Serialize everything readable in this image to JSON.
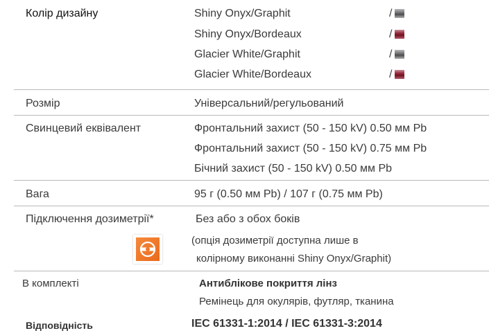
{
  "design_color": {
    "label": "Колір дизайну",
    "options": [
      {
        "name": "Shiny Onyx/Graphit",
        "separator": "/",
        "swatch": "graphit",
        "color": "#5a5a5e"
      },
      {
        "name": "Shiny Onyx/Bordeaux",
        "separator": "/",
        "swatch": "bordeaux",
        "color": "#8a2535"
      },
      {
        "name": "Glacier White/Graphit",
        "separator": "/",
        "swatch": "graphit",
        "color": "#5a5a5e"
      },
      {
        "name": "Glacier White/Bordeaux",
        "separator": "/",
        "swatch": "bordeaux",
        "color": "#8a2535"
      }
    ]
  },
  "size": {
    "label": "Розмір",
    "value": "Універсальний/регульований"
  },
  "lead_equivalent": {
    "label": "Свинцевий еквівалент",
    "values": [
      "Фронтальний захист (50 - 150 kV) 0.50 мм Pb",
      "Фронтальний захист (50 - 150 kV) 0.75 мм Pb",
      "Бічний захист (50 - 150 kV) 0.50 мм Pb"
    ]
  },
  "weight": {
    "label": "Вага",
    "value": "95 г (0.50 мм Pb) / 107 г (0.75 мм Pb)"
  },
  "dosimetry": {
    "label": "Підключення дозиметрії*",
    "value": "Без або з обох боків",
    "note_line1": "(опція дозиметрії доступна лише в",
    "note_line2": "колірному виконанні Shiny Onyx/Graphit)",
    "icon": "dosimeter-icon",
    "icon_color": "#f07a2a"
  },
  "included": {
    "label": "В комплекті",
    "item1": "Антиблікове покриття лінз",
    "item2": "Ремінець для окулярів, футляр, тканина"
  },
  "compliance": {
    "label": "Відповідність",
    "value": "IEC 61331-1:2014 / IEC 61331-3:2014"
  }
}
